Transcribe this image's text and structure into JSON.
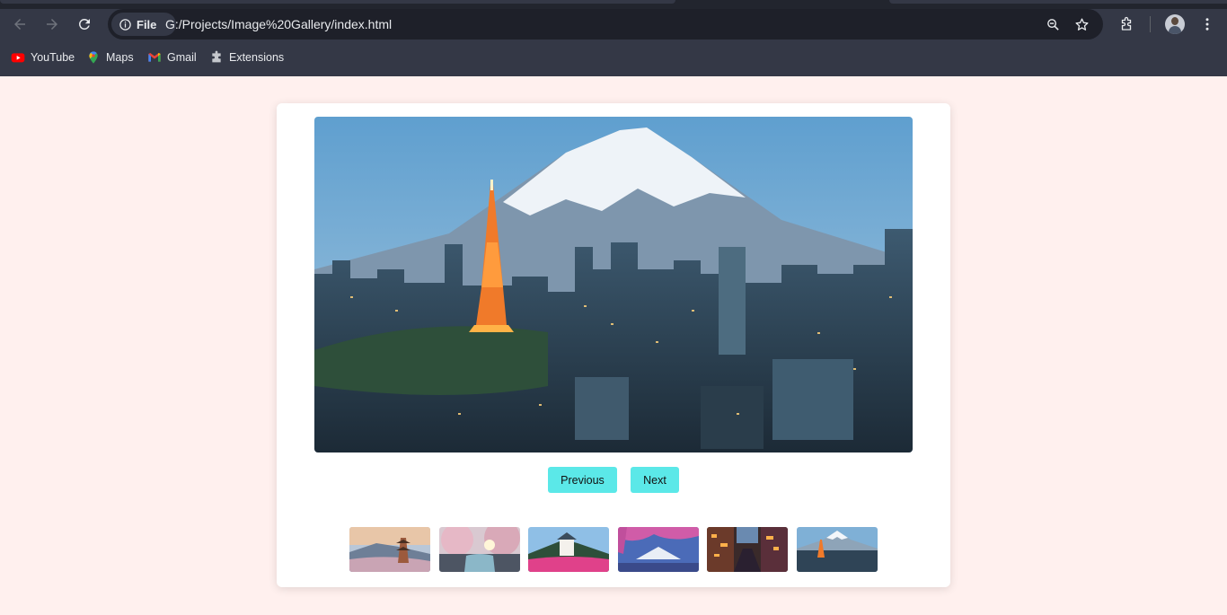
{
  "browser": {
    "chip_label": "File",
    "url": "G:/Projects/Image%20Gallery/index.html",
    "bookmarks": [
      {
        "label": "YouTube",
        "icon": "youtube-icon"
      },
      {
        "label": "Maps",
        "icon": "maps-icon"
      },
      {
        "label": "Gmail",
        "icon": "gmail-icon"
      },
      {
        "label": "Extensions",
        "icon": "extensions-icon"
      }
    ]
  },
  "gallery": {
    "main_image": "tokyo-tower-mount-fuji",
    "previous_label": "Previous",
    "next_label": "Next",
    "thumbnails": [
      "pagoda-mount-fuji",
      "cherry-blossom-river",
      "castle-pink-flowers",
      "mount-fuji-cherry-blossoms",
      "city-street-night",
      "tokyo-tower-mount-fuji"
    ]
  },
  "colors": {
    "page_background": "#fff0ee",
    "button_background": "#5be8e8",
    "chrome_background": "#343846"
  }
}
